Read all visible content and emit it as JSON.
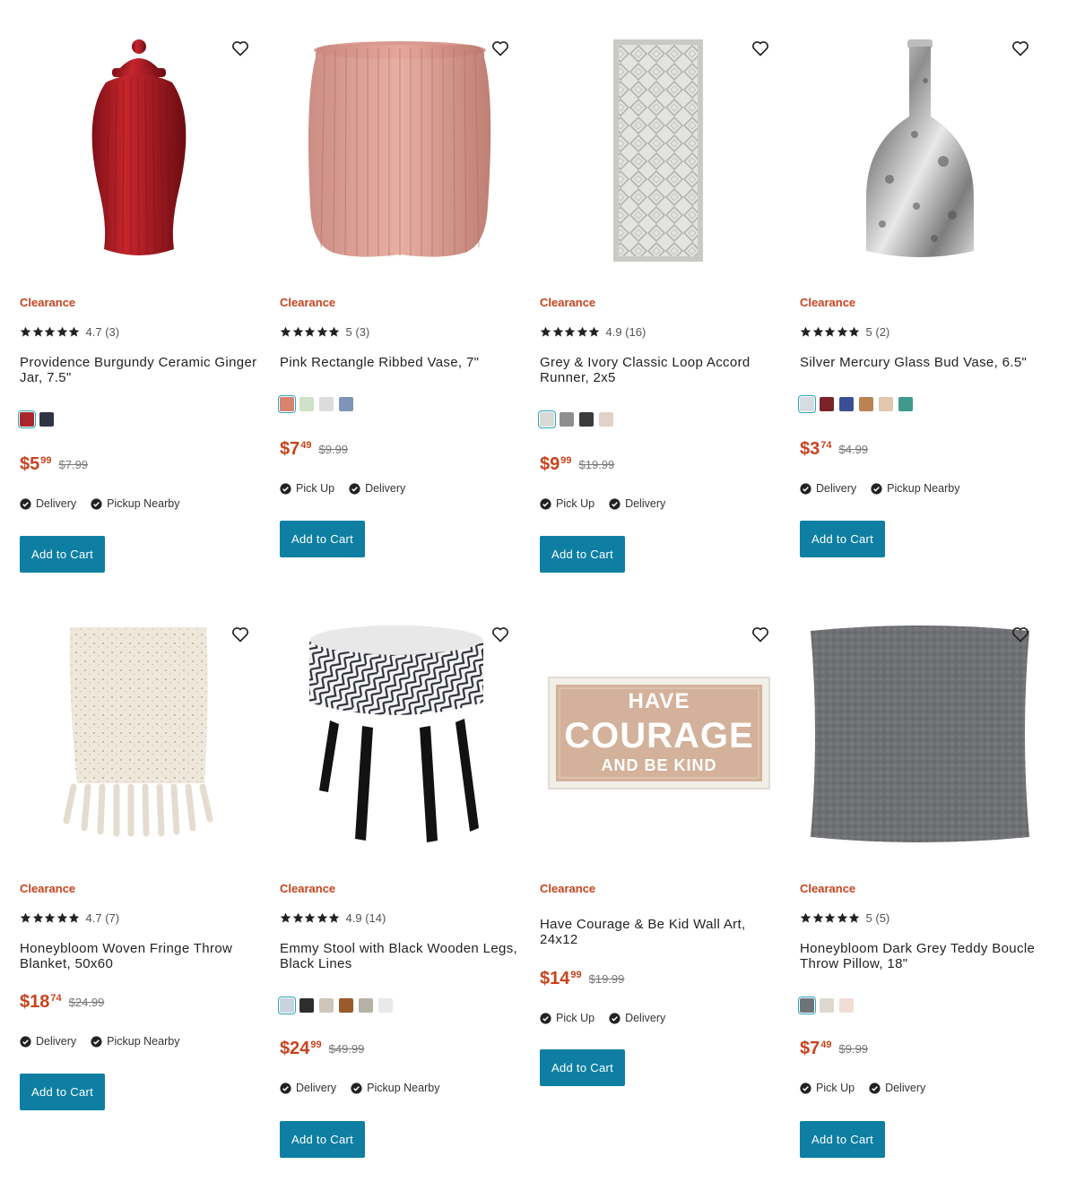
{
  "products": [
    {
      "badge": "Clearance",
      "rating": "4.7",
      "reviews": "(3)",
      "title": "Providence Burgundy Ceramic Ginger Jar, 7.5\"",
      "swatches": [
        "#a8272a",
        "#2f3445"
      ],
      "selected_swatch": 0,
      "price_dollars": "$5",
      "price_cents": "99",
      "was_price": "$7.99",
      "fulfillment": [
        "Delivery",
        "Pickup Nearby"
      ],
      "cta": "Add to Cart",
      "image_icon": "ginger-jar-image",
      "heart_icon": "heart-icon"
    },
    {
      "badge": "Clearance",
      "rating": "5",
      "reviews": "(3)",
      "title": "Pink Rectangle Ribbed Vase, 7\"",
      "swatches": [
        "#d8836f",
        "#cfe1c7",
        "#dcdcdc",
        "#7e95b8"
      ],
      "selected_swatch": 0,
      "price_dollars": "$7",
      "price_cents": "49",
      "was_price": "$9.99",
      "fulfillment": [
        "Pick Up",
        "Delivery"
      ],
      "cta": "Add to Cart",
      "image_icon": "ribbed-vase-image",
      "heart_icon": "heart-icon"
    },
    {
      "badge": "Clearance",
      "rating": "4.9",
      "reviews": "(16)",
      "title": "Grey & Ivory Classic Loop Accord Runner, 2x5",
      "swatches": [
        "#d9d9d6",
        "#8e8e8e",
        "#3b3b3b",
        "#e0d2c8"
      ],
      "selected_swatch": 0,
      "price_dollars": "$9",
      "price_cents": "99",
      "was_price": "$19.99",
      "fulfillment": [
        "Pick Up",
        "Delivery"
      ],
      "cta": "Add to Cart",
      "image_icon": "rug-runner-image",
      "heart_icon": "heart-icon"
    },
    {
      "badge": "Clearance",
      "rating": "5",
      "reviews": "(2)",
      "title": "Silver Mercury Glass Bud Vase, 6.5\"",
      "swatches": [
        "#d6dde2",
        "#7a2328",
        "#3c4f94",
        "#b98353",
        "#e0c7ad",
        "#3f9a8c"
      ],
      "selected_swatch": 0,
      "price_dollars": "$3",
      "price_cents": "74",
      "was_price": "$4.99",
      "fulfillment": [
        "Delivery",
        "Pickup Nearby"
      ],
      "cta": "Add to Cart",
      "image_icon": "mercury-vase-image",
      "heart_icon": "heart-icon"
    },
    {
      "badge": "Clearance",
      "rating": "4.7",
      "reviews": "(7)",
      "title": "Honeybloom Woven Fringe Throw Blanket, 50x60",
      "swatches": [],
      "selected_swatch": -1,
      "price_dollars": "$18",
      "price_cents": "74",
      "was_price": "$24.99",
      "fulfillment": [
        "Delivery",
        "Pickup Nearby"
      ],
      "cta": "Add to Cart",
      "image_icon": "throw-blanket-image",
      "heart_icon": "heart-icon"
    },
    {
      "badge": "Clearance",
      "rating": "4.9",
      "reviews": "(14)",
      "title": "Emmy Stool with Black Wooden Legs, Black Lines",
      "swatches": [
        "#c9d3dd",
        "#2d2d2d",
        "#cfc6bb",
        "#9a5a2c",
        "#b8b2a6",
        "#e9e9e9"
      ],
      "selected_swatch": 0,
      "price_dollars": "$24",
      "price_cents": "99",
      "was_price": "$49.99",
      "fulfillment": [
        "Delivery",
        "Pickup Nearby"
      ],
      "cta": "Add to Cart",
      "image_icon": "stool-image",
      "heart_icon": "heart-icon"
    },
    {
      "badge": "Clearance",
      "rating": "",
      "reviews": "",
      "title": "Have Courage & Be Kid Wall Art, 24x12",
      "swatches": [],
      "selected_swatch": -1,
      "price_dollars": "$14",
      "price_cents": "99",
      "was_price": "$19.99",
      "fulfillment": [
        "Pick Up",
        "Delivery"
      ],
      "cta": "Add to Cart",
      "image_icon": "wall-art-image",
      "heart_icon": "heart-icon",
      "art_text": [
        "HAVE",
        "COURAGE",
        "AND BE KIND"
      ]
    },
    {
      "badge": "Clearance",
      "rating": "5",
      "reviews": "(5)",
      "title": "Honeybloom Dark Grey Teddy Boucle Throw Pillow, 18\"",
      "swatches": [
        "#6e7379",
        "#ddd8d0",
        "#f1dcd6"
      ],
      "selected_swatch": 0,
      "price_dollars": "$7",
      "price_cents": "49",
      "was_price": "$9.99",
      "fulfillment": [
        "Pick Up",
        "Delivery"
      ],
      "cta": "Add to Cart",
      "image_icon": "throw-pillow-image",
      "heart_icon": "heart-icon"
    }
  ],
  "colors": {
    "clearance": "#c8431d",
    "price": "#c8431d",
    "button": "#0e7fa3",
    "swatch_selected": "#2aa5b8"
  }
}
